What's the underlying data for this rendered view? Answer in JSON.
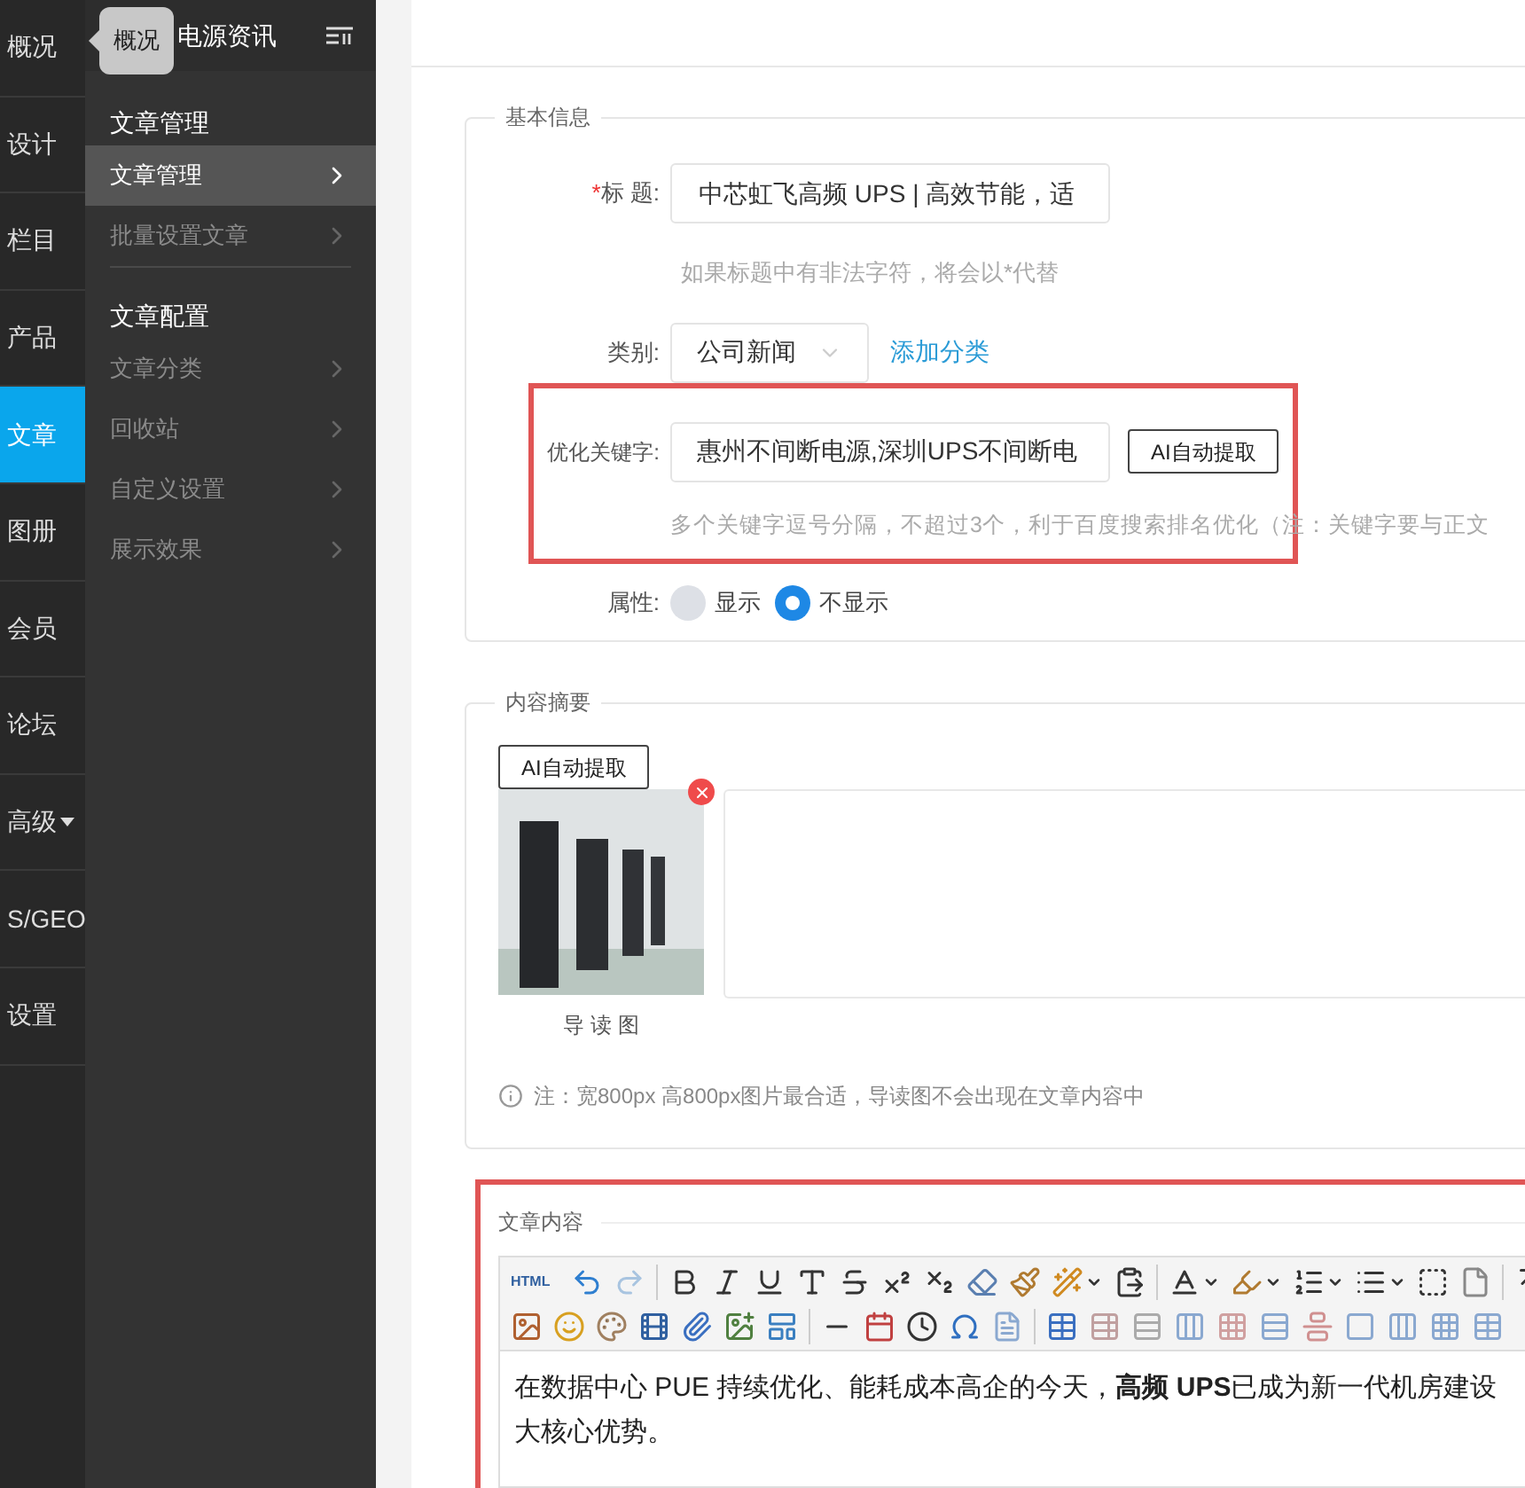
{
  "nav": [
    {
      "label": "概况",
      "selected": false,
      "dropdown": false
    },
    {
      "label": "设计",
      "selected": false,
      "dropdown": false
    },
    {
      "label": "栏目",
      "selected": false,
      "dropdown": false
    },
    {
      "label": "产品",
      "selected": false,
      "dropdown": false
    },
    {
      "label": "文章",
      "selected": true,
      "dropdown": false
    },
    {
      "label": "图册",
      "selected": false,
      "dropdown": false
    },
    {
      "label": "会员",
      "selected": false,
      "dropdown": false
    },
    {
      "label": "论坛",
      "selected": false,
      "dropdown": false
    },
    {
      "label": "高级",
      "selected": false,
      "dropdown": true
    },
    {
      "label": "S/GEO",
      "selected": false,
      "dropdown": false
    },
    {
      "label": "设置",
      "selected": false,
      "dropdown": false
    }
  ],
  "tooltip": "概况",
  "sidebar": {
    "title": "电源资讯",
    "groups": [
      {
        "heading": "文章管理",
        "items": [
          {
            "label": "文章管理",
            "selected": true
          },
          {
            "label": "批量设置文章",
            "selected": false
          }
        ]
      },
      {
        "heading": "文章配置",
        "items": [
          {
            "label": "文章分类",
            "selected": false
          },
          {
            "label": "回收站",
            "selected": false
          },
          {
            "label": "自定义设置",
            "selected": false
          },
          {
            "label": "展示效果",
            "selected": false
          }
        ]
      }
    ]
  },
  "basic_info": {
    "legend": "基本信息",
    "title_field": {
      "required_mark": "*",
      "label": "标 题:",
      "value": "中芯虹飞高频 UPS | 高效节能，适",
      "hint": "如果标题中有非法字符，将会以*代替"
    },
    "category": {
      "label": "类别:",
      "value": "公司新闻",
      "add_link": "添加分类"
    },
    "keywords": {
      "label": "优化关键字:",
      "value": "惠州不间断电源,深圳UPS不间断电",
      "button": "AI自动提取",
      "hint": "多个关键字逗号分隔，不超过3个，利于百度搜索排名优化（注：关键字要与正文"
    },
    "attribute": {
      "label": "属性:",
      "options": [
        {
          "label": "显示",
          "selected": false
        },
        {
          "label": "不显示",
          "selected": true
        }
      ]
    }
  },
  "summary": {
    "legend": "内容摘要",
    "button": "AI自动提取",
    "image_caption": "导 读 图",
    "note": "注：宽800px 高800px图片最合适，导读图不会出现在文章内容中"
  },
  "content": {
    "legend": "文章内容",
    "html_button": "HTML",
    "lines": [
      "在数据中心 PUE 持续优化、能耗成本高企的今天，**高频 UPS**已成为新一代机房建设",
      "大核心优势。"
    ]
  }
}
